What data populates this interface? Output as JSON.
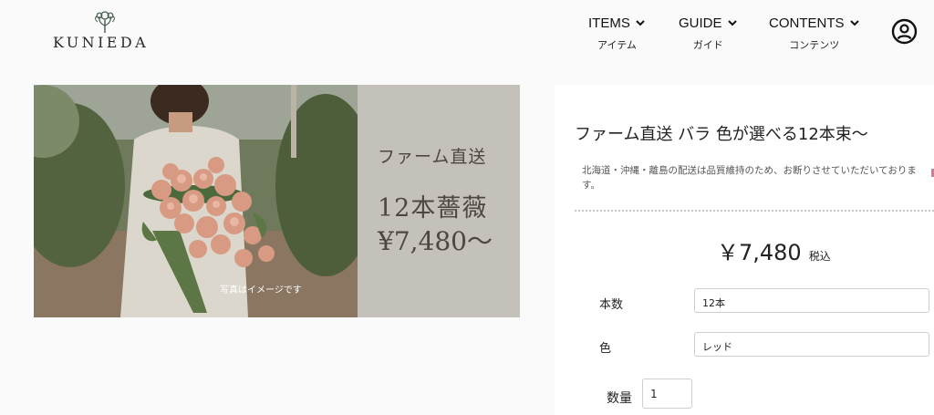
{
  "brand": {
    "name": "KUNIEDA",
    "logo_icon": "flower-bouquet-logo"
  },
  "nav": [
    {
      "label": "ITEMS",
      "sub": "アイテム",
      "icon": "chevron-down-icon"
    },
    {
      "label": "GUIDE",
      "sub": "ガイド",
      "icon": "chevron-down-icon"
    },
    {
      "label": "CONTENTS",
      "sub": "コンテンツ",
      "icon": "chevron-down-icon"
    }
  ],
  "account_icon": "user-circle-icon",
  "hero": {
    "tag": "ファーム直送",
    "count": "12本薔薇",
    "price": "¥7,480〜",
    "note": "写真はイメージです",
    "panel_color": "#c4c1bb"
  },
  "product": {
    "title": "ファーム直送 バラ 色が選べる12本束〜",
    "notice": "北海道・沖縄・離島の配送は品質維持のため、お断りさせていただいております。",
    "price": "￥7,480",
    "tax_label": "税込",
    "options": [
      {
        "label": "本数",
        "value": "12本"
      },
      {
        "label": "色",
        "value": "レッド"
      }
    ],
    "quantity": {
      "label": "数量",
      "value": "1"
    }
  },
  "colors": {
    "accent": "#d37aa0",
    "background": "#fafafa"
  }
}
